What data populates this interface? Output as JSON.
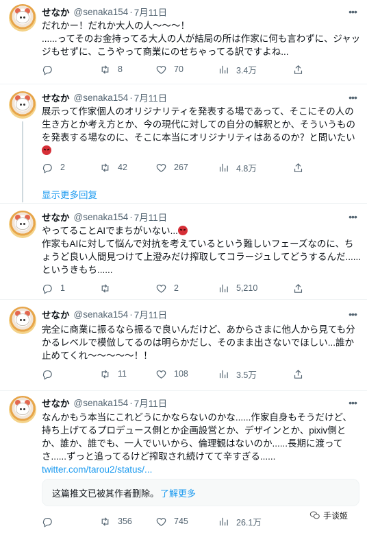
{
  "tweets": [
    {
      "name": "せなか",
      "handle": "@senaka154",
      "sep": "·",
      "date": "7月11日",
      "text": "だれかー！だれか大人の人〜〜〜！\n......ってそのお金持ってる大人の人が結局の所は作家に何も言わずに、ジャッジもせずに、こうやって商業にのせちゃってる訳ですよね...",
      "reply_count": "",
      "retweet_count": "8",
      "like_count": "70",
      "view_count": "3.4万"
    },
    {
      "name": "せなか",
      "handle": "@senaka154",
      "sep": "·",
      "date": "7月11日",
      "text": "展示って作家個人のオリジナリティを発表する場であって、そこにその人の生き方とか考え方とか、今の現代に対しての自分の解釈とか、そういうものを発表する場なのに、そこに本当にオリジナリティはあるのか？と問いたい",
      "reply_count": "2",
      "retweet_count": "42",
      "like_count": "267",
      "view_count": "4.8万"
    },
    {
      "name": "せなか",
      "handle": "@senaka154",
      "sep": "·",
      "date": "7月11日",
      "text_line1": "やってることAIでまちがいない...",
      "text_rest": "作家もAIに対して悩んで対抗を考えているという難しいフェーズなのに、ちょうど良い人間見つけて上澄みだけ搾取してコラージュしてどうするんだ......というきもち......",
      "reply_count": "1",
      "retweet_count": "",
      "like_count": "2",
      "view_count": "5,210"
    },
    {
      "name": "せなか",
      "handle": "@senaka154",
      "sep": "·",
      "date": "7月11日",
      "text": "完全に商業に振るなら振るで良いんだけど、あからさまに他人から見ても分かるレベルで模倣してるのは明らかだし、そのまま出さないでほしい...誰か止めてくれ〜〜〜〜〜！！",
      "reply_count": "",
      "retweet_count": "11",
      "like_count": "108",
      "view_count": "3.5万"
    },
    {
      "name": "せなか",
      "handle": "@senaka154",
      "sep": "·",
      "date": "7月11日",
      "text": "なんかもう本当にこれどうにかならないのかな......作家自身もそうだけど、持ち上げてるプロデュース側とか企画設営とか、デザインとか、pixiv側とか、誰か、誰でも、一人でいいから、倫理観はないのか......長期に渡ってさ......ずっと追ってるけど搾取され続けてて辛すぎる......",
      "link": "twitter.com/tarou2/status/...",
      "deleted_notice": "这篇推文已被其作者删除。",
      "learn_more": "了解更多",
      "reply_count": "",
      "retweet_count": "356",
      "like_count": "745",
      "view_count": "26.1万"
    }
  ],
  "show_more_replies": "显示更多回复",
  "watermark_text": "手谈姬",
  "icons": {
    "reply": "reply-icon",
    "retweet": "retweet-icon",
    "like": "heart-icon",
    "views": "views-icon",
    "share": "share-icon",
    "more": "more-dots-icon"
  }
}
